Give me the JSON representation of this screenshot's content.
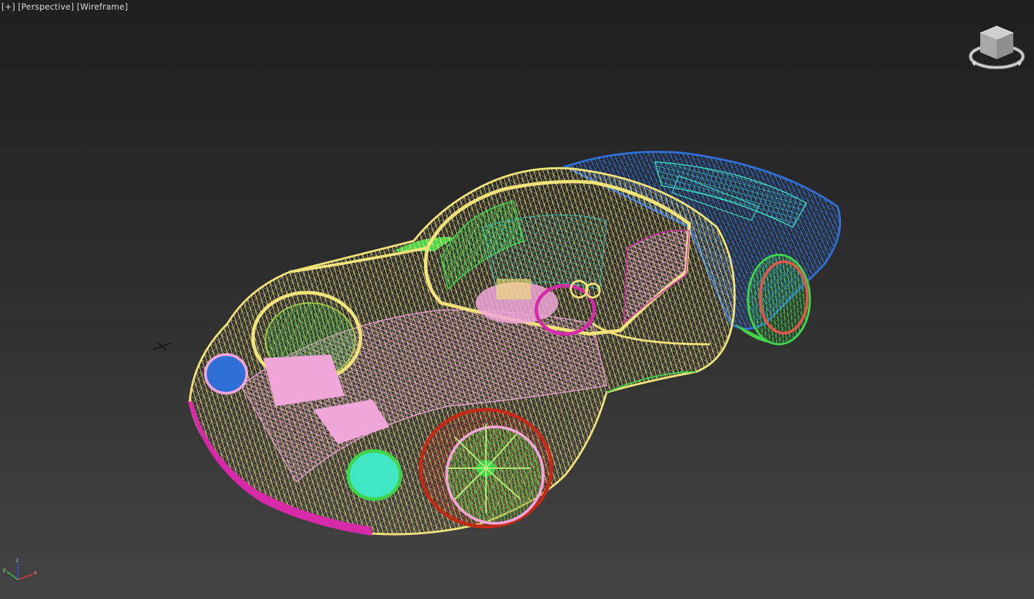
{
  "viewport": {
    "menu_label": "[+]",
    "view_label": "[Perspective]",
    "shading_label": "[Wireframe]"
  },
  "scene": {
    "object": "sports-car-wireframe",
    "colors": {
      "body": "#f2e27a",
      "rear": "#2f6fd6",
      "rear_accent": "#39d9c2",
      "green": "#3fd44a",
      "pink": "#f0a6d8",
      "magenta": "#d62aa8",
      "tire": "#c42a18",
      "cyan": "#43e6c4"
    }
  },
  "axis": {
    "x": "x",
    "y": "y",
    "z": "z"
  },
  "icons": {
    "viewcube": "viewcube-icon",
    "tripod": "axis-tripod-icon",
    "pivot": "pivot-marker-icon"
  }
}
